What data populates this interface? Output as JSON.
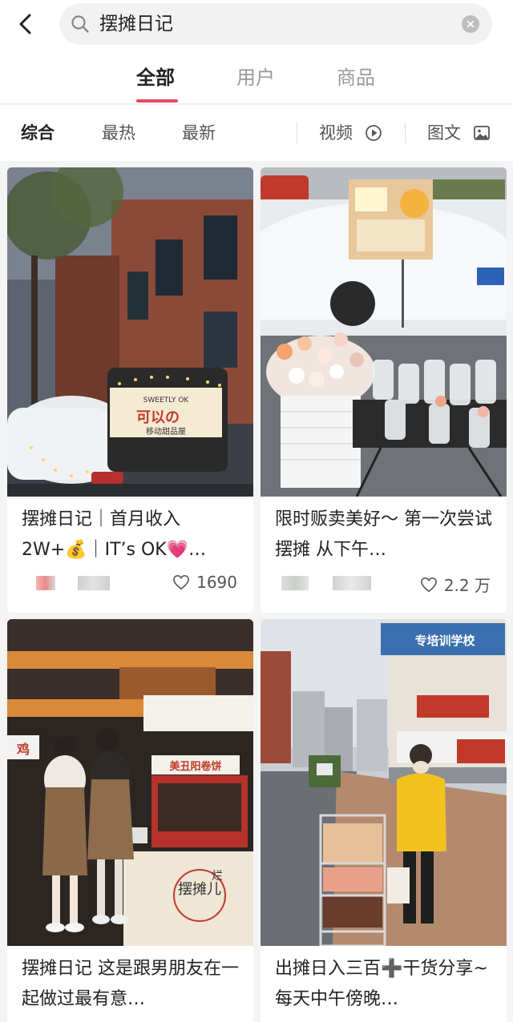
{
  "search": {
    "query": "摆摊日记"
  },
  "tabs": [
    {
      "label": "全部",
      "active": true
    },
    {
      "label": "用户",
      "active": false
    },
    {
      "label": "商品",
      "active": false
    }
  ],
  "filters": {
    "items": [
      {
        "label": "综合",
        "active": true
      },
      {
        "label": "最热",
        "active": false
      },
      {
        "label": "最新",
        "active": false
      }
    ],
    "video_label": "视频",
    "image_text_label": "图文"
  },
  "cards": [
    {
      "title": "摆摊日记｜首月收入2W+💰｜IT’s OK💗…",
      "likes": "1690"
    },
    {
      "title": "限时贩卖美好～ 第一次尝试摆摊 从下午…",
      "likes": "2.2 万"
    },
    {
      "title": "摆摊日记 这是跟男朋友在一起做过最有意…",
      "likes": ""
    },
    {
      "title": "出摊日入三百➕干货分享~ 每天中午傍晚…",
      "likes": ""
    }
  ],
  "photo_text": {
    "card1_sign_top": "SWEETLY OK",
    "card1_sign_main": "可以の",
    "card1_sign_sub": "移动甜品屋",
    "card3_sign_left": "鸡",
    "card3_banner": "美丑阳卷饼",
    "card3_cart": "摆摊儿",
    "card3_cart2": "烂",
    "card4_school": "专培训学校"
  },
  "colors": {
    "accent": "#e84a5f",
    "like_text": "#555555"
  }
}
